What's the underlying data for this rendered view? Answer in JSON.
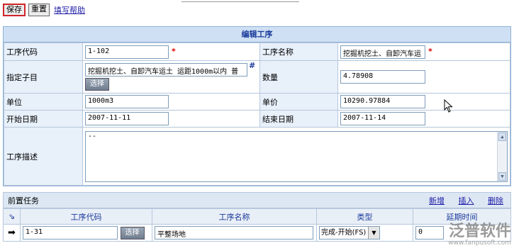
{
  "toolbar": {
    "save": "保存",
    "reset": "重置",
    "help": "填写帮助"
  },
  "panel_title": "编辑工序",
  "form": {
    "code_label": "工序代码",
    "code_value": "1-102",
    "name_label": "工序名称",
    "name_value": "挖掘机挖土、自卸汽车运",
    "subitem_label": "指定子目",
    "subitem_value": "挖掘机挖土、自卸汽车运土 运距1000m以内 普",
    "choose": "选择",
    "qty_label": "数量",
    "qty_value": "4.78908",
    "unit_label": "单位",
    "unit_value": "1000m3",
    "price_label": "单价",
    "price_value": "10290.97884",
    "start_label": "开始日期",
    "start_value": "2007-11-11",
    "end_label": "结束日期",
    "end_value": "2007-11-14",
    "desc_label": "工序描述",
    "desc_value": "--",
    "required_mark": "*",
    "hash_mark": "#"
  },
  "pre": {
    "title": "前置任务",
    "actions": [
      "新增",
      "插入",
      "删除"
    ],
    "columns": [
      "工序代码",
      "工序名称",
      "类型",
      "延期时间"
    ],
    "rows": [
      {
        "code": "1-31",
        "choose": "选择",
        "name": "平整场地",
        "type": "完成-开始(FS)",
        "delay": "0"
      }
    ]
  },
  "watermark": {
    "brand": "泛普软件",
    "url": "www.fanpusoft.com"
  },
  "colors": {
    "title_text": "#1a3a9a",
    "label_bg": "#e8f0fa",
    "required": "#dd0000"
  }
}
